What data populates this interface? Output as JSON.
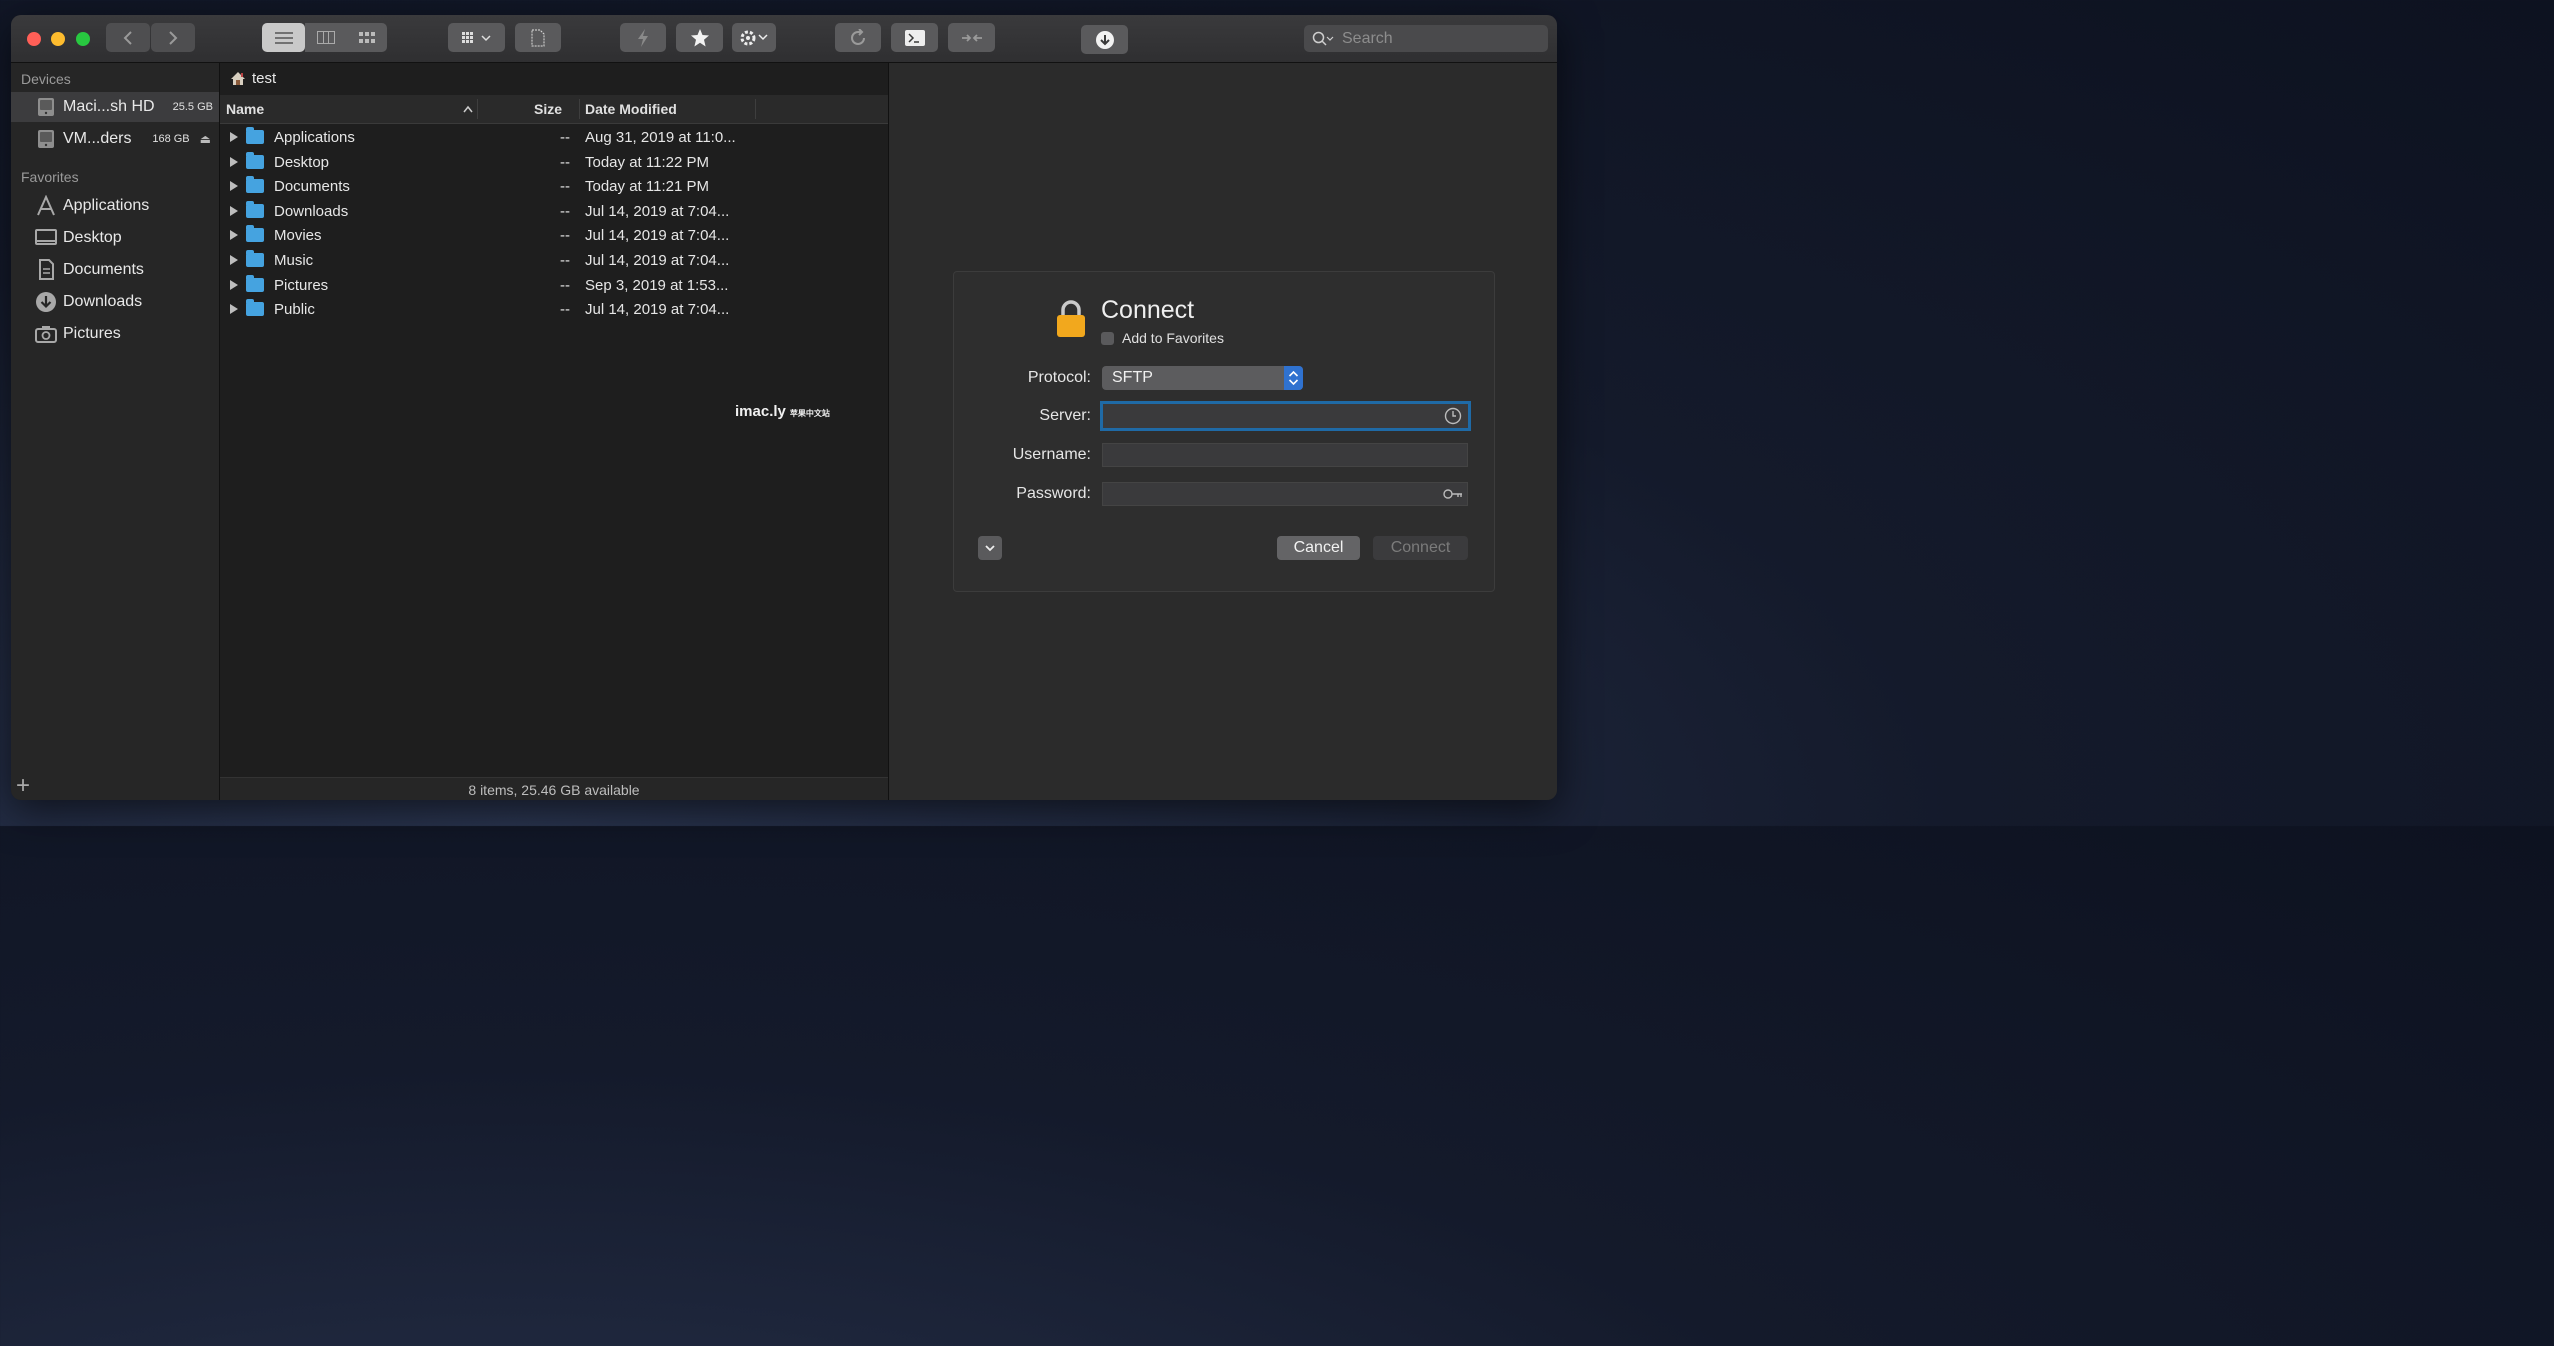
{
  "toolbar": {
    "search_placeholder": "Search",
    "icons": [
      "back-arrow-icon",
      "forward-arrow-icon",
      "list-view-icon",
      "column-view-icon",
      "icon-view-icon",
      "grid-menu-icon",
      "document-icon",
      "bolt-icon",
      "star-icon",
      "gear-icon",
      "refresh-icon",
      "terminal-icon",
      "shrink-icon",
      "download-icon",
      "search-icon"
    ]
  },
  "sidebar": {
    "devices_heading": "Devices",
    "devices": [
      {
        "label": "Maci...sh HD",
        "capacity": "25.5 GB"
      },
      {
        "label": "VM...ders",
        "capacity": "168 GB"
      }
    ],
    "favorites_heading": "Favorites",
    "favorites": [
      {
        "label": "Applications",
        "icon": "applications-icon"
      },
      {
        "label": "Desktop",
        "icon": "desktop-icon"
      },
      {
        "label": "Documents",
        "icon": "documents-icon"
      },
      {
        "label": "Downloads",
        "icon": "downloads-icon"
      },
      {
        "label": "Pictures",
        "icon": "pictures-icon"
      }
    ],
    "add_label": "+"
  },
  "browser": {
    "path": "test",
    "columns": {
      "name": "Name",
      "size": "Size",
      "date": "Date Modified"
    },
    "rows": [
      {
        "name": "Applications",
        "size": "--",
        "date": "Aug 31, 2019 at 11:0..."
      },
      {
        "name": "Desktop",
        "size": "--",
        "date": "Today at 11:22 PM"
      },
      {
        "name": "Documents",
        "size": "--",
        "date": "Today at 11:21 PM"
      },
      {
        "name": "Downloads",
        "size": "--",
        "date": "Jul 14, 2019 at 7:04..."
      },
      {
        "name": "Movies",
        "size": "--",
        "date": "Jul 14, 2019 at 7:04..."
      },
      {
        "name": "Music",
        "size": "--",
        "date": "Jul 14, 2019 at 7:04..."
      },
      {
        "name": "Pictures",
        "size": "--",
        "date": "Sep 3, 2019 at 1:53..."
      },
      {
        "name": "Public",
        "size": "--",
        "date": "Jul 14, 2019 at 7:04..."
      }
    ],
    "status": "8 items, 25.46 GB available",
    "watermark": "imac.ly",
    "watermark_sub": "苹果中文站"
  },
  "connect": {
    "title": "Connect",
    "add_to_favorites": "Add to Favorites",
    "protocol_label": "Protocol:",
    "protocol_value": "SFTP",
    "server_label": "Server:",
    "username_label": "Username:",
    "password_label": "Password:",
    "cancel": "Cancel",
    "connect": "Connect"
  }
}
